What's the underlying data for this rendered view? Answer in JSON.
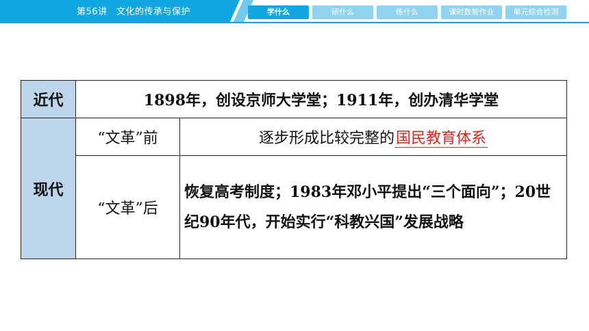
{
  "header": {
    "lesson_title": "第56讲　文化的传承与保护",
    "tabs": [
      {
        "label": "学什么",
        "active": true
      },
      {
        "label": "研什么",
        "active": false
      },
      {
        "label": "练什么",
        "active": false
      },
      {
        "label": "课时数智作业",
        "active": false
      },
      {
        "label": "单元综合检测",
        "active": false
      }
    ],
    "colors": {
      "banner": "#12a7e0",
      "tab_inactive": "#8fd3ef"
    }
  },
  "table": {
    "row_modern_early": {
      "label": "近代",
      "content": "1898年，创设京师大学堂；1911年，创办清华学堂"
    },
    "row_contemporary": {
      "label": "现代",
      "before": {
        "period": "“文革”前",
        "text_prefix": "逐步形成比较完整的",
        "answer": "国民教育体系"
      },
      "after": {
        "period": "“文革”后",
        "content": "恢复高考制度；1983年邓小平提出“三个面向”；20世纪90年代，开始实行“科教兴国”发展战略"
      }
    },
    "colors": {
      "label_bg": "#bcd5ea",
      "answer": "#e2231a"
    }
  }
}
